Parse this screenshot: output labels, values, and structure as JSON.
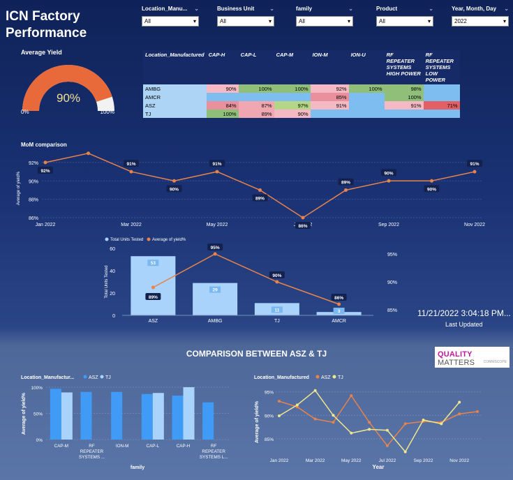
{
  "title": "ICN Factory Performance",
  "filters": [
    {
      "label": "Location_Manu...",
      "value": "All"
    },
    {
      "label": "Business Unit",
      "value": "All"
    },
    {
      "label": "family",
      "value": "All"
    },
    {
      "label": "Product",
      "value": "All"
    },
    {
      "label": "Year, Month, Day",
      "value": "2022"
    }
  ],
  "gauge": {
    "title": "Average Yield",
    "value": 0.9,
    "value_label": "90%",
    "min_label": "0%",
    "max_label": "100%",
    "fill_color": "#e8693a",
    "track_color": "#f2f2f2"
  },
  "matrix": {
    "columns": [
      "Location_Manufactured",
      "CAP-H",
      "CAP-L",
      "CAP-M",
      "ION-M",
      "ION-U",
      "RF REPEATER SYSTEMS HIGH POWER",
      "RF REPEATER SYSTEMS LOW POWER"
    ],
    "rows": [
      {
        "name": "AMBG",
        "cells": [
          "90%",
          "100%",
          "100%",
          "92%",
          "100%",
          "98%",
          ""
        ]
      },
      {
        "name": "AMCR",
        "cells": [
          "",
          "",
          "",
          "85%",
          "",
          "100%",
          ""
        ]
      },
      {
        "name": "ASZ",
        "cells": [
          "84%",
          "87%",
          "97%",
          "91%",
          "",
          "91%",
          "71%"
        ]
      },
      {
        "name": "TJ",
        "cells": [
          "100%",
          "89%",
          "90%",
          "",
          "",
          "",
          ""
        ]
      }
    ]
  },
  "mom": {
    "title": "MoM comparison",
    "ylabel": "Average of yield%",
    "months": [
      "Jan 2022",
      "Feb 2022",
      "Mar 2022",
      "Apr 2022",
      "May 2022",
      "Jun 2022",
      "Jul 2022",
      "Aug 2022",
      "Sep 2022",
      "Oct 2022",
      "Nov 2022"
    ],
    "x_ticks": [
      "Jan 2022",
      "Mar 2022",
      "May 2022",
      "Jul 2022",
      "Sep 2022",
      "Nov 2022"
    ],
    "values": [
      92,
      93,
      91,
      90,
      91,
      89,
      86,
      89,
      90,
      90,
      91
    ],
    "labels": [
      "92%",
      "93%",
      "91%",
      "90%",
      "91%",
      "89%",
      "86%",
      "89%",
      "90%",
      "90%",
      "91%"
    ],
    "y_ticks": [
      "92%",
      "90%",
      "88%",
      "86%"
    ],
    "ylim": [
      86,
      92.6
    ]
  },
  "combo": {
    "legend": [
      "Total Units Tested",
      "Average of yield%"
    ],
    "ylabel": "Total Units Tested",
    "categories": [
      "ASZ",
      "AMBG",
      "TJ",
      "AMCR"
    ],
    "units": [
      53,
      29,
      11,
      3
    ],
    "unit_labels": [
      "53",
      "29",
      "11",
      "3"
    ],
    "yield": [
      89,
      95,
      90,
      86
    ],
    "yield_labels": [
      "89%",
      "95%",
      "90%",
      "86%"
    ],
    "left_ticks": [
      "60",
      "40",
      "20",
      "0"
    ],
    "right_ticks": [
      "95%",
      "90%",
      "85%"
    ]
  },
  "timestamp": "11/21/2022 3:04:18 PM...",
  "last_updated": "Last Updated",
  "comparison_title": "COMPARISON BETWEEN ASZ & TJ",
  "logo": {
    "brand": "QUALITY",
    "brand2": "MATTERS",
    "sub": "COMMSCOPE"
  },
  "bar_compare": {
    "legend_title": "Location_Manufactur...",
    "series": [
      {
        "name": "ASZ",
        "color": "#3f9bf5"
      },
      {
        "name": "TJ",
        "color": "#a9d3fb"
      }
    ],
    "categories": [
      "CAP-M",
      "RF REPEATER SYSTEMS ...",
      "ION-M",
      "CAP-L",
      "CAP-H",
      "RF REPEATER SYSTEMS L..."
    ],
    "asz": [
      97,
      91,
      91,
      87,
      84,
      71
    ],
    "tj": [
      90,
      null,
      null,
      89,
      100,
      null
    ],
    "ylabel": "Average of yield%",
    "xlabel": "family",
    "y_ticks": [
      "100%",
      "50%",
      "0%"
    ]
  },
  "line_compare": {
    "legend_title": "Location_Manufactured",
    "series": [
      {
        "name": "ASZ",
        "color": "#e8834a"
      },
      {
        "name": "TJ",
        "color": "#f0e68c"
      }
    ],
    "months": 12,
    "asz": [
      93,
      91.8,
      89.2,
      88.5,
      94.2,
      88.5,
      83.5,
      88.2,
      88.7,
      88.5,
      90.3,
      90.8
    ],
    "tj": [
      89.9,
      92.2,
      95.3,
      90,
      86.2,
      87,
      86.8,
      82.2,
      89,
      88.2,
      92.8
    ],
    "ylabel": "Average of yield%",
    "xlabel": "Year",
    "x_ticks": [
      "Jan 2022",
      "Mar 2022",
      "May 2022",
      "Jul 2022",
      "Sep 2022",
      "Nov 2022"
    ],
    "y_ticks": [
      "95%",
      "90%",
      "85%"
    ]
  }
}
